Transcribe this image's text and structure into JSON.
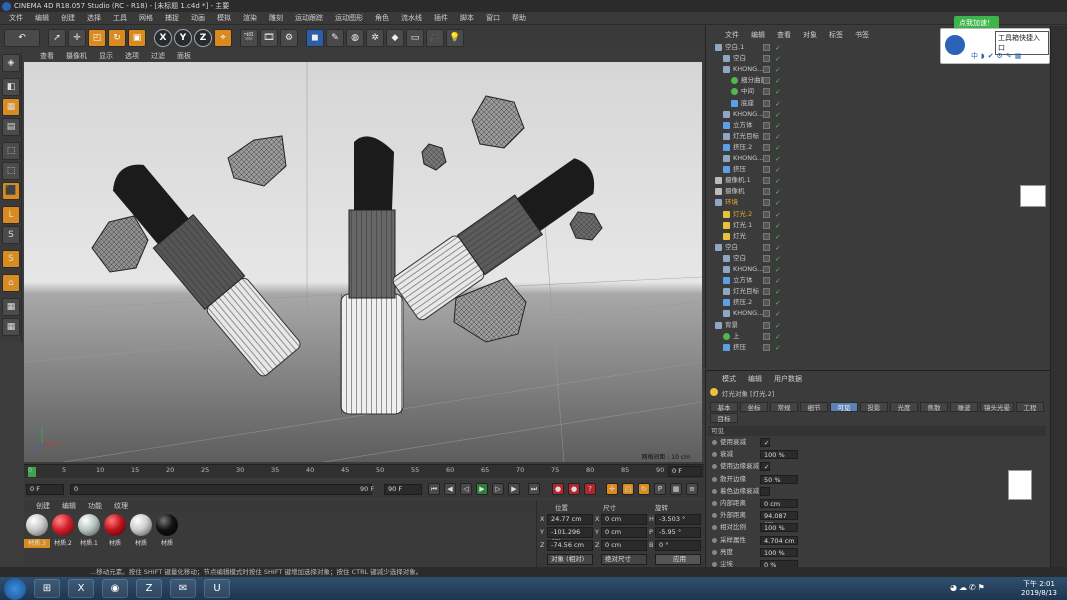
{
  "window": {
    "title": "CINEMA 4D R18.057 Studio (RC - R18) - [未标题 1.c4d *] - 主要"
  },
  "menubar": [
    "文件",
    "编辑",
    "创建",
    "选择",
    "工具",
    "网格",
    "捕捉",
    "动画",
    "模拟",
    "渲染",
    "雕刻",
    "运动跟踪",
    "运动图形",
    "角色",
    "流水线",
    "插件",
    "脚本",
    "窗口",
    "帮助"
  ],
  "viewport_menu": [
    "查看",
    "摄像机",
    "显示",
    "选项",
    "过滤",
    "面板"
  ],
  "viewport": {
    "grid_label": "网格间距 : 10 cm"
  },
  "timeline": {
    "ticks": [
      "0",
      "5",
      "10",
      "15",
      "20",
      "25",
      "30",
      "35",
      "40",
      "45",
      "50",
      "55",
      "60",
      "65",
      "70",
      "75",
      "80",
      "85",
      "90"
    ],
    "frame_field": "0 F"
  },
  "timeline_ctrl": {
    "start": "0 F",
    "end": "90 F",
    "end2": "90 F",
    "current": "0"
  },
  "materials": {
    "menu": [
      "创建",
      "编辑",
      "功能",
      "纹理"
    ],
    "items": [
      {
        "label": "材质.3",
        "color": "#c8c8c8"
      },
      {
        "label": "材质.2",
        "color": "#d3202a"
      },
      {
        "label": "材质.1",
        "color": "#b7c4c0"
      },
      {
        "label": "材质",
        "color": "#c0141c"
      },
      {
        "label": "材质",
        "color": "#cccccc"
      },
      {
        "label": "材质",
        "color": "#111111"
      }
    ]
  },
  "coords": {
    "headers": [
      "位置",
      "尺寸",
      "旋转"
    ],
    "rows": [
      {
        "axis": "X",
        "pos": "24.77 cm",
        "size_axis": "X",
        "size": "0 cm",
        "rot_axis": "H",
        "rot": "-3.503 °"
      },
      {
        "axis": "Y",
        "pos": "-101.296 cm",
        "size_axis": "Y",
        "size": "0 cm",
        "rot_axis": "P",
        "rot": "-5.95 °"
      },
      {
        "axis": "Z",
        "pos": "-74.56 cm",
        "size_axis": "Z",
        "size": "0 cm",
        "rot_axis": "B",
        "rot": "0 °"
      }
    ],
    "mode1": "对象 (相对)",
    "mode2": "绝对尺寸",
    "apply": "应用"
  },
  "object_manager": {
    "menu": [
      "文件",
      "编辑",
      "查看",
      "对象",
      "标签",
      "书签"
    ],
    "rows": [
      {
        "name": "空白.1",
        "indent": 0,
        "kind": "null"
      },
      {
        "name": "空白",
        "indent": 1,
        "kind": "null"
      },
      {
        "name": "KHONG...",
        "indent": 1,
        "kind": "null"
      },
      {
        "name": "细分曲面",
        "indent": 2,
        "kind": "green"
      },
      {
        "name": "中间",
        "indent": 2,
        "kind": "green"
      },
      {
        "name": "底座",
        "indent": 2,
        "kind": "blue"
      },
      {
        "name": "KHONG...",
        "indent": 1,
        "kind": "null"
      },
      {
        "name": "立方体",
        "indent": 1,
        "kind": "blue"
      },
      {
        "name": "灯光目标",
        "indent": 1,
        "kind": "null"
      },
      {
        "name": "挤压.2",
        "indent": 1,
        "kind": "blue"
      },
      {
        "name": "KHONG...",
        "indent": 1,
        "kind": "null"
      },
      {
        "name": "挤压",
        "indent": 1,
        "kind": "blue"
      },
      {
        "name": "摄像机.1",
        "indent": 0,
        "kind": "cam"
      },
      {
        "name": "摄像机",
        "indent": 0,
        "kind": "cam"
      },
      {
        "name": "环境",
        "indent": 0,
        "kind": "null",
        "highlight": true
      },
      {
        "name": "灯光.2",
        "indent": 1,
        "kind": "light",
        "highlight": true
      },
      {
        "name": "灯光.1",
        "indent": 1,
        "kind": "light"
      },
      {
        "name": "灯光",
        "indent": 1,
        "kind": "light"
      },
      {
        "name": "空白",
        "indent": 0,
        "kind": "null"
      },
      {
        "name": "空白",
        "indent": 1,
        "kind": "null"
      },
      {
        "name": "KHONG...",
        "indent": 1,
        "kind": "null"
      },
      {
        "name": "立方体",
        "indent": 1,
        "kind": "blue"
      },
      {
        "name": "灯光目标",
        "indent": 1,
        "kind": "null"
      },
      {
        "name": "挤压.2",
        "indent": 1,
        "kind": "blue"
      },
      {
        "name": "KHONG...",
        "indent": 1,
        "kind": "null"
      },
      {
        "name": "背景",
        "indent": 0,
        "kind": "null"
      },
      {
        "name": "上",
        "indent": 1,
        "kind": "green"
      },
      {
        "name": "挤压",
        "indent": 1,
        "kind": "blue"
      }
    ]
  },
  "attributes": {
    "menu": [
      "模式",
      "编辑",
      "用户数据"
    ],
    "title": "灯光对象 [灯光.2]",
    "tabs": [
      "基本",
      "坐标",
      "常规",
      "细节",
      "可见",
      "投影",
      "光度",
      "焦散",
      "噪波",
      "镜头光晕",
      "工程",
      "目标"
    ],
    "active_tab": "可见",
    "section": "可见",
    "fields": [
      {
        "label": "使用衰减",
        "value": "✓"
      },
      {
        "label": "衰减",
        "value": "100 %"
      },
      {
        "label": "使用边缘衰减",
        "value": "✓"
      },
      {
        "label": "散开边缘",
        "value": "50 %"
      },
      {
        "label": "着色边缘衰减",
        "value": ""
      },
      {
        "label": "内部距离",
        "value": "0 cm"
      },
      {
        "label": "外部距离",
        "value": "94.087 cm"
      },
      {
        "label": "相对比例",
        "value": "100 %"
      },
      {
        "label": "采样属性",
        "value": "4.704 cm"
      },
      {
        "label": "亮度",
        "value": "100 %"
      },
      {
        "label": "尘埃",
        "value": "0 %"
      }
    ]
  },
  "status": "...移动元素。按住 SHIFT 键量化移动；节点编辑模式时按住 SHIFT 键增加选择对象；按住 CTRL 键减少选择对象。",
  "helper": {
    "green_button": "点我加速！",
    "title": "工具箱快捷入口"
  },
  "taskbar": {
    "time": "下午 2:01",
    "date": "2019/8/13"
  }
}
